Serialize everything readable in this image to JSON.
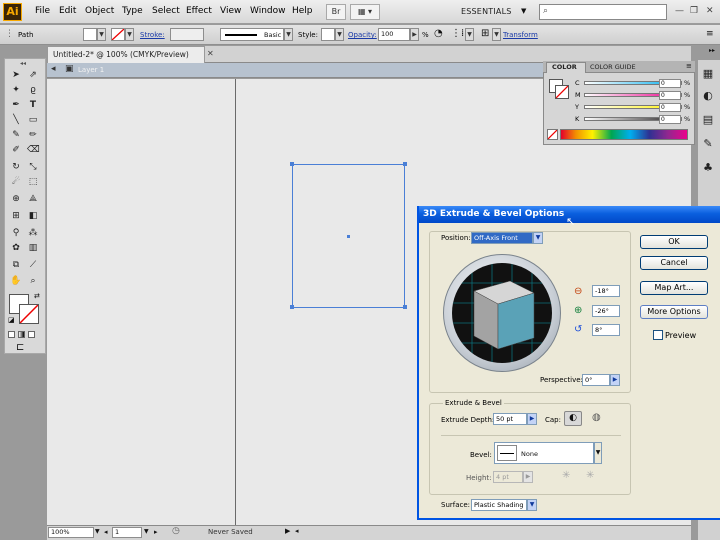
{
  "menubar": {
    "logo": "Ai",
    "items": [
      "File",
      "Edit",
      "Object",
      "Type",
      "Select",
      "Effect",
      "View",
      "Window",
      "Help"
    ],
    "workspace": "ESSENTIALS",
    "search_placeholder": ""
  },
  "controlbar": {
    "selection_label": "Path",
    "stroke_label": "Stroke:",
    "stroke_style": "Basic",
    "style_label": "Style:",
    "opacity_label": "Opacity:",
    "opacity_value": "100",
    "opacity_unit": "%",
    "transform_link": "Transform"
  },
  "document": {
    "tab_title": "Untitled-2* @ 100% (CMYK/Preview)",
    "layer_name": "Layer 1"
  },
  "statusbar": {
    "zoom": "100%",
    "page": "1",
    "status": "Never Saved"
  },
  "color_panel": {
    "tabs": [
      "COLOR",
      "COLOR GUIDE"
    ],
    "channels": [
      {
        "label": "C",
        "value": "0",
        "unit": "%",
        "color": "#00aeef"
      },
      {
        "label": "M",
        "value": "0",
        "unit": "%",
        "color": "#ec008c"
      },
      {
        "label": "Y",
        "value": "0",
        "unit": "%",
        "color": "#fff200"
      },
      {
        "label": "K",
        "value": "0",
        "unit": "%",
        "color": "#231f20"
      }
    ]
  },
  "dialog": {
    "title": "3D Extrude & Bevel Options",
    "position_label": "Position:",
    "position_value": "Off-Axis Front",
    "rotation_x": "-18°",
    "rotation_y": "-26°",
    "rotation_z": "8°",
    "perspective_label": "Perspective:",
    "perspective_value": "0°",
    "extrude_group": "Extrude & Bevel",
    "extrude_depth_label": "Extrude Depth:",
    "extrude_depth_value": "50 pt",
    "cap_label": "Cap:",
    "bevel_label": "Bevel:",
    "bevel_value": "None",
    "height_label": "Height:",
    "height_value": "4 pt",
    "surface_label": "Surface:",
    "surface_value": "Plastic Shading",
    "ok": "OK",
    "cancel": "Cancel",
    "map_art": "Map Art...",
    "more_options": "More Options",
    "preview": "Preview"
  }
}
